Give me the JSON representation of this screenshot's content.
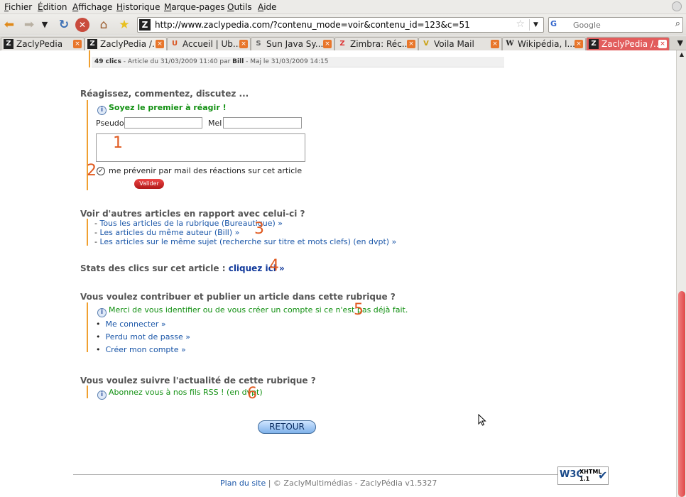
{
  "menu": [
    "Fichier",
    "Édition",
    "Affichage",
    "Historique",
    "Marque-pages",
    "Outils",
    "Aide"
  ],
  "toolbar": {
    "url": "http://www.zaclypedia.com/?contenu_mode=voir&contenu_id=123&c=51",
    "search_engine": "G",
    "search_placeholder": "Google"
  },
  "tabs": [
    {
      "label": "ZaclyPedia",
      "icon": "Z"
    },
    {
      "label": "ZaclyPedia /...",
      "icon": "Z"
    },
    {
      "label": "Accueil | Ub...",
      "icon": "U"
    },
    {
      "label": "Sun Java Sy...",
      "icon": "S"
    },
    {
      "label": "Zimbra: Réc...",
      "icon": "Z"
    },
    {
      "label": "Voila Mail",
      "icon": "V"
    },
    {
      "label": "Wikipédia, l...",
      "icon": "W"
    },
    {
      "label": "ZaclyPedia /...",
      "icon": "Z"
    }
  ],
  "meta": {
    "clicks": "49 clics",
    "article_prefix": " - Article du 31/03/2009 11:40 par ",
    "author": "Bill",
    "update": " - Maj le 31/03/2009 14:15"
  },
  "react": {
    "title": "Réagissez, commentez, discutez ...",
    "first": "Soyez le premier à réagir !",
    "pseudo_label": "Pseudo",
    "mel_label": "Mel",
    "notify_label": "me prévenir par mail des réactions sur cet article",
    "submit": "Valider"
  },
  "related": {
    "title": "Voir d'autres articles en rapport avec celui-ci ?",
    "links": [
      "Tous les articles de la rubrique (Bureautique) »",
      "Les articles du même auteur (Bill) »",
      "Les articles sur le même sujet (recherche sur titre et mots clefs) (en dvpt) »"
    ]
  },
  "stats": {
    "title": "Stats des clics sur cet article :",
    "link": "cliquez ici »"
  },
  "contribute": {
    "title": "Vous voulez contribuer et publier un article dans cette rubrique ?",
    "info": "Merci de vous identifier ou de vous créer un compte si ce n'est pas déjà fait.",
    "links": [
      "Me connecter »",
      "Perdu mot de passe »",
      "Créer mon compte »"
    ]
  },
  "follow": {
    "title": "Vous voulez suivre l'actualité de cette rubrique ?",
    "info": "Abonnez vous à nos fils RSS ! (en dvpt)"
  },
  "annotations": [
    "1",
    "2",
    "3",
    "4",
    "5",
    "6"
  ],
  "retour": "RETOUR",
  "footer": {
    "plan": "Plan du site",
    "rest": " | © ZaclyMultimédias   - ZaclyPédia v1.5327"
  },
  "badge": {
    "w3c": "W3C",
    "xhtml": "XHTML",
    "version": "1.1"
  },
  "colors": {
    "accent_bar": "#f0a030",
    "link": "#1a56a8",
    "info_green": "#129012",
    "annotation": "#e05a20"
  }
}
